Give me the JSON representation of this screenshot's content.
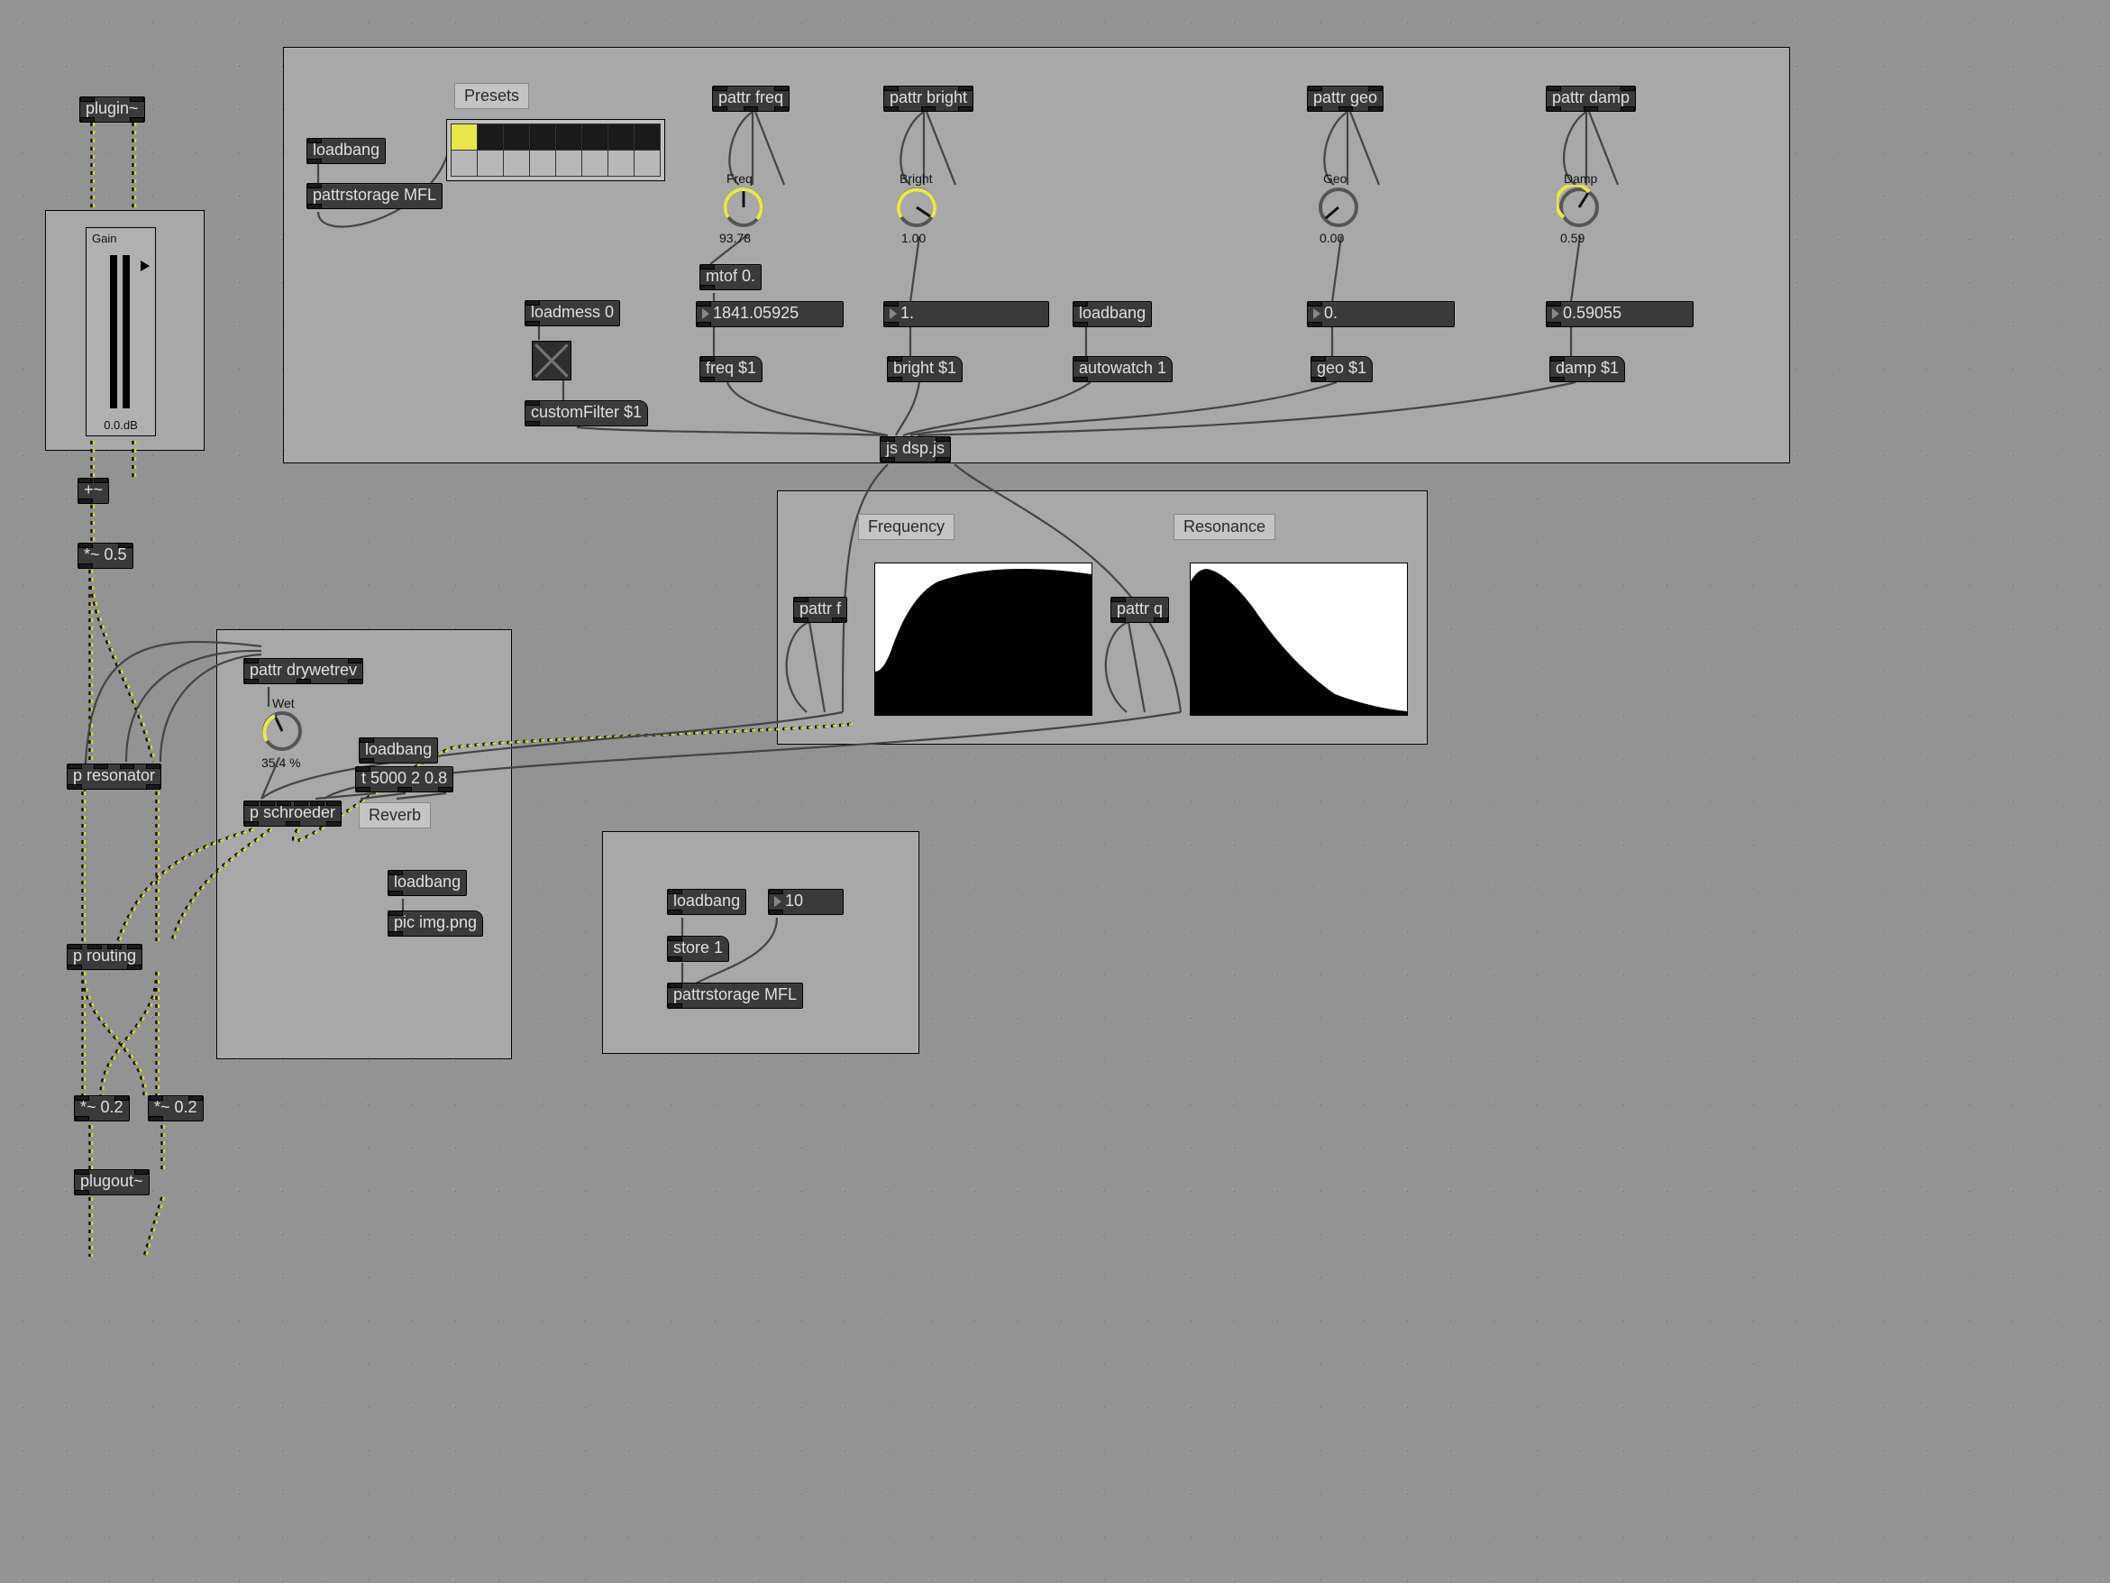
{
  "plugin": "plugin~",
  "plugout": "plugout~",
  "gain": {
    "label": "Gain",
    "db": "0.0.dB"
  },
  "sum": "+~",
  "half": "*~ 0.5",
  "resonator": "p resonator",
  "routing": "p routing",
  "mul02a": "*~ 0.2",
  "mul02b": "*~ 0.2",
  "panel_main": {
    "presets_label": "Presets",
    "loadbang": "loadbang",
    "pattrstorage": "pattrstorage MFL",
    "loadmess0": "loadmess 0",
    "customfilter": "customFilter $1",
    "jsdsp": "js dsp.js",
    "lb_autowatch": "loadbang",
    "autowatch": "autowatch 1",
    "freq": {
      "pattr": "pattr freq",
      "dial_label": "Freq",
      "dial_val": "93.78",
      "mtof": "mtof 0.",
      "numbox": "1841.05925",
      "msg": "freq $1"
    },
    "bright": {
      "pattr": "pattr bright",
      "dial_label": "Bright",
      "dial_val": "1.00",
      "numbox": "1.",
      "msg": "bright $1"
    },
    "geo": {
      "pattr": "pattr geo",
      "dial_label": "Geo",
      "dial_val": "0.00",
      "numbox": "0.",
      "msg": "geo $1"
    },
    "damp": {
      "pattr": "pattr damp",
      "dial_label": "Damp",
      "dial_val": "0.59",
      "numbox": "0.59055",
      "msg": "damp $1"
    }
  },
  "panel_filter": {
    "freq_label": "Frequency",
    "res_label": "Resonance",
    "pattr_f": "pattr f",
    "pattr_q": "pattr q"
  },
  "panel_reverb": {
    "pattr": "pattr drywetrev",
    "dial_label": "Wet",
    "dial_val": "35.4 %",
    "loadbang": "loadbang",
    "t5000": "t 5000 2 0.8",
    "schroeder": "p schroeder",
    "reverb_label": "Reverb",
    "loadbang2": "loadbang",
    "picimg": "pic img.png"
  },
  "panel_store": {
    "loadbang": "loadbang",
    "store1": "store 1",
    "num10": "10",
    "pattrstorage": "pattrstorage MFL"
  }
}
